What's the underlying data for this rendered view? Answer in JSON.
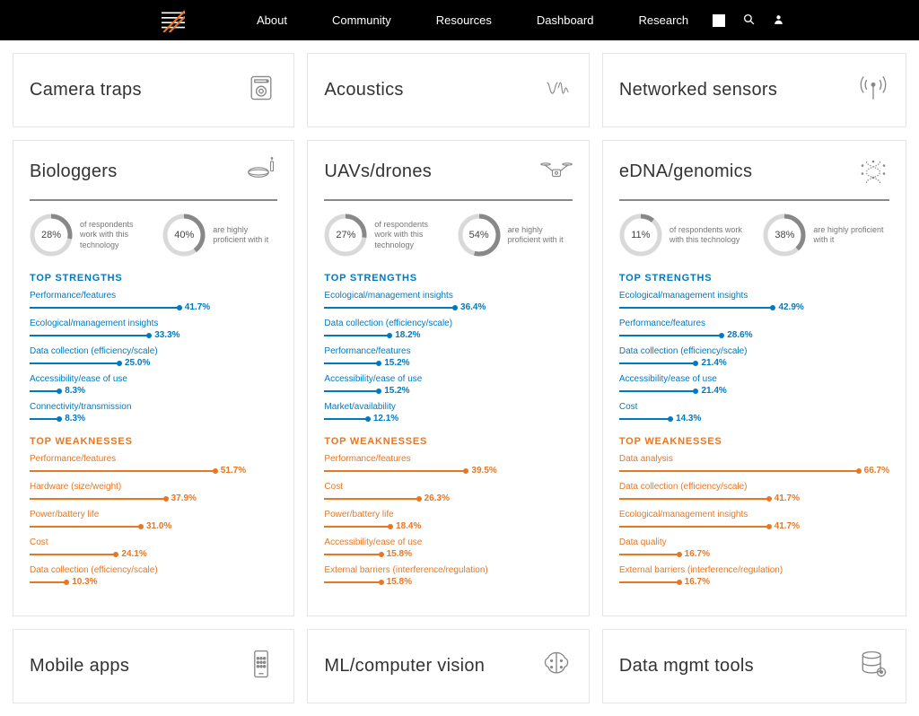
{
  "nav": {
    "links": [
      "About",
      "Community",
      "Resources",
      "Dashboard",
      "Research"
    ]
  },
  "colors": {
    "strength": "#0079c1",
    "weakness": "#e87722",
    "donut_track": "#d9d9d9",
    "donut_fill": "#888888"
  },
  "scale_note": "bar widths are drawn as percent × 4 px",
  "labels": {
    "respondents": "of respondents work with this technology",
    "proficient": "are highly proficient with it",
    "top_strengths": "TOP STRENGTHS",
    "top_weaknesses": "TOP WEAKNESSES"
  },
  "cards_top": [
    {
      "title": "Camera traps",
      "icon": "camera-trap-icon"
    },
    {
      "title": "Acoustics",
      "icon": "acoustic-icon"
    },
    {
      "title": "Networked sensors",
      "icon": "antenna-icon"
    }
  ],
  "cards_detail": [
    {
      "title": "Biologgers",
      "icon": "collar-icon",
      "work_pct": 28,
      "prof_pct": 40,
      "strengths": [
        {
          "label": "Performance/features",
          "pct": 41.7
        },
        {
          "label": "Ecological/management insights",
          "pct": 33.3
        },
        {
          "label": "Data collection (efficiency/scale)",
          "pct": 25.0
        },
        {
          "label": "Accessibility/ease of use",
          "pct": 8.3
        },
        {
          "label": "Connectivity/transmission",
          "pct": 8.3
        }
      ],
      "weaknesses": [
        {
          "label": "Performance/features",
          "pct": 51.7
        },
        {
          "label": "Hardware (size/weight)",
          "pct": 37.9
        },
        {
          "label": "Power/battery life",
          "pct": 31.0
        },
        {
          "label": "Cost",
          "pct": 24.1
        },
        {
          "label": "Data collection (efficiency/scale)",
          "pct": 10.3
        }
      ]
    },
    {
      "title": "UAVs/drones",
      "icon": "drone-icon",
      "work_pct": 27,
      "prof_pct": 54,
      "strengths": [
        {
          "label": "Ecological/management insights",
          "pct": 36.4
        },
        {
          "label": "Data collection (efficiency/scale)",
          "pct": 18.2
        },
        {
          "label": "Performance/features",
          "pct": 15.2
        },
        {
          "label": "Accessibility/ease of use",
          "pct": 15.2
        },
        {
          "label": "Market/availability",
          "pct": 12.1
        }
      ],
      "weaknesses": [
        {
          "label": "Performance/features",
          "pct": 39.5
        },
        {
          "label": "Cost",
          "pct": 26.3
        },
        {
          "label": "Power/battery life",
          "pct": 18.4
        },
        {
          "label": "Accessibility/ease of use",
          "pct": 15.8
        },
        {
          "label": "External barriers (interference/regulation)",
          "pct": 15.8
        }
      ]
    },
    {
      "title": "eDNA/genomics",
      "icon": "dna-icon",
      "work_pct": 11,
      "prof_pct": 38,
      "strengths": [
        {
          "label": "Ecological/management insights",
          "pct": 42.9
        },
        {
          "label": "Performance/features",
          "pct": 28.6
        },
        {
          "label": "Data collection (efficiency/scale)",
          "pct": 21.4
        },
        {
          "label": "Accessibility/ease of use",
          "pct": 21.4
        },
        {
          "label": "Cost",
          "pct": 14.3
        }
      ],
      "weaknesses": [
        {
          "label": "Data analysis",
          "pct": 66.7
        },
        {
          "label": "Data collection (efficiency/scale)",
          "pct": 41.7
        },
        {
          "label": "Ecological/management insights",
          "pct": 41.7
        },
        {
          "label": "Data quality",
          "pct": 16.7
        },
        {
          "label": "External barriers (interference/regulation)",
          "pct": 16.7
        }
      ]
    }
  ],
  "cards_bottom": [
    {
      "title": "Mobile apps",
      "icon": "mobile-icon"
    },
    {
      "title": "ML/computer vision",
      "icon": "brain-icon"
    },
    {
      "title": "Data mgmt tools",
      "icon": "database-icon"
    }
  ],
  "chart_data": [
    {
      "card": "Biologgers",
      "type": "bar",
      "title": "TOP STRENGTHS",
      "categories": [
        "Performance/features",
        "Ecological/management insights",
        "Data collection (efficiency/scale)",
        "Accessibility/ease of use",
        "Connectivity/transmission"
      ],
      "values": [
        41.7,
        33.3,
        25.0,
        8.3,
        8.3
      ],
      "xlim": [
        0,
        70
      ],
      "ylabel": "%"
    },
    {
      "card": "Biologgers",
      "type": "bar",
      "title": "TOP WEAKNESSES",
      "categories": [
        "Performance/features",
        "Hardware (size/weight)",
        "Power/battery life",
        "Cost",
        "Data collection (efficiency/scale)"
      ],
      "values": [
        51.7,
        37.9,
        31.0,
        24.1,
        10.3
      ],
      "xlim": [
        0,
        70
      ],
      "ylabel": "%"
    },
    {
      "card": "UAVs/drones",
      "type": "bar",
      "title": "TOP STRENGTHS",
      "categories": [
        "Ecological/management insights",
        "Data collection (efficiency/scale)",
        "Performance/features",
        "Accessibility/ease of use",
        "Market/availability"
      ],
      "values": [
        36.4,
        18.2,
        15.2,
        15.2,
        12.1
      ],
      "xlim": [
        0,
        70
      ],
      "ylabel": "%"
    },
    {
      "card": "UAVs/drones",
      "type": "bar",
      "title": "TOP WEAKNESSES",
      "categories": [
        "Performance/features",
        "Cost",
        "Power/battery life",
        "Accessibility/ease of use",
        "External barriers (interference/regulation)"
      ],
      "values": [
        39.5,
        26.3,
        18.4,
        15.8,
        15.8
      ],
      "xlim": [
        0,
        70
      ],
      "ylabel": "%"
    },
    {
      "card": "eDNA/genomics",
      "type": "bar",
      "title": "TOP STRENGTHS",
      "categories": [
        "Ecological/management insights",
        "Performance/features",
        "Data collection (efficiency/scale)",
        "Accessibility/ease of use",
        "Cost"
      ],
      "values": [
        42.9,
        28.6,
        21.4,
        21.4,
        14.3
      ],
      "xlim": [
        0,
        70
      ],
      "ylabel": "%"
    },
    {
      "card": "eDNA/genomics",
      "type": "bar",
      "title": "TOP WEAKNESSES",
      "categories": [
        "Data analysis",
        "Data collection (efficiency/scale)",
        "Ecological/management insights",
        "Data quality",
        "External barriers (interference/regulation)"
      ],
      "values": [
        66.7,
        41.7,
        41.7,
        16.7,
        16.7
      ],
      "xlim": [
        0,
        70
      ],
      "ylabel": "%"
    }
  ]
}
